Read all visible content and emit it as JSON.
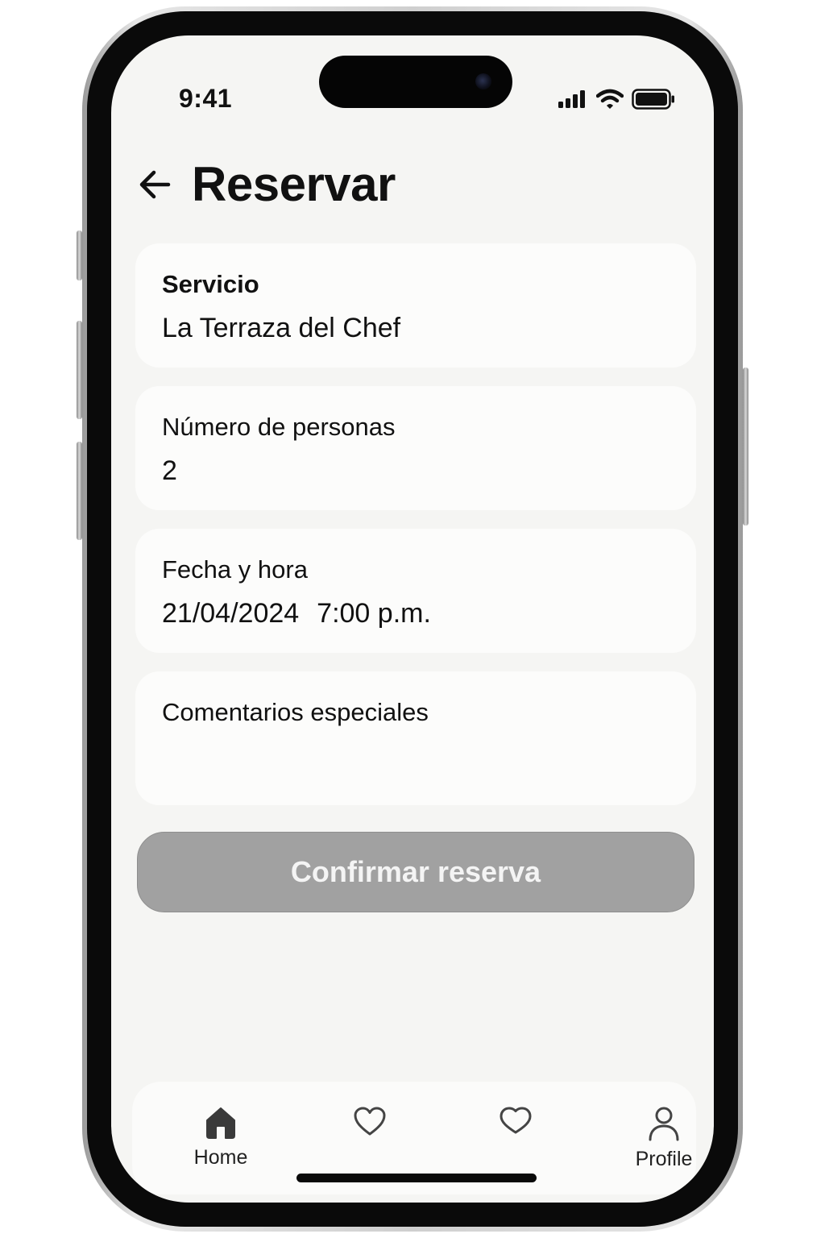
{
  "status_bar": {
    "time": "9:41"
  },
  "header": {
    "title": "Reservar",
    "back_icon": "arrow-left-icon"
  },
  "form": {
    "service": {
      "label": "Servicio",
      "value": "La Terraza del Chef"
    },
    "people": {
      "label": "Número de personas",
      "value": "2"
    },
    "datetime": {
      "label": "Fecha y hora",
      "date": "21/04/2024",
      "time": "7:00 p.m."
    },
    "comments": {
      "label": "Comentarios especiales",
      "value": ""
    }
  },
  "confirm_button": {
    "label": "Confirmar reserva",
    "color": "#a1a1a1"
  },
  "tab_bar": {
    "tabs": [
      {
        "label": "Home",
        "icon": "home-icon"
      },
      {
        "label": "",
        "icon": "heart-icon"
      },
      {
        "label": "",
        "icon": "heart-icon"
      },
      {
        "label": "Profile",
        "icon": "user-icon"
      }
    ]
  }
}
